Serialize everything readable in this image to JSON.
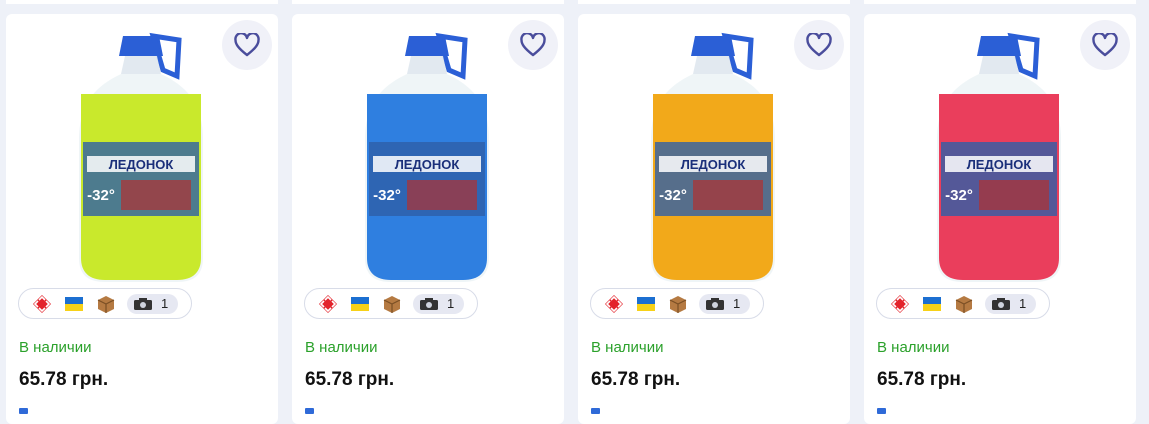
{
  "products": [
    {
      "liquid_color": "#c9e92c",
      "availability": "В наличии",
      "price": "65.78 грн.",
      "photo_count": "1",
      "label_text": "ЛЕДОНОК",
      "label_temp": "-32°"
    },
    {
      "liquid_color": "#2f7fe0",
      "availability": "В наличии",
      "price": "65.78 грн.",
      "photo_count": "1",
      "label_text": "ЛЕДОНОК",
      "label_temp": "-32°"
    },
    {
      "liquid_color": "#f2a91a",
      "availability": "В наличии",
      "price": "65.78 грн.",
      "photo_count": "1",
      "label_text": "ЛЕДОНОК",
      "label_temp": "-32°"
    },
    {
      "liquid_color": "#ea3e5c",
      "availability": "В наличии",
      "price": "65.78 грн.",
      "photo_count": "1",
      "label_text": "ЛЕДОНОК",
      "label_temp": "-32°"
    }
  ],
  "icons": {
    "favorite": "heart-icon",
    "delivery": "nova-poshta-icon",
    "origin": "ukraine-flag-icon",
    "package": "package-icon",
    "photos": "camera-icon"
  },
  "colors": {
    "background": "#eef1f8",
    "availability": "#2ba12b",
    "heart": "#4a4d9c",
    "delivery_red": "#e3232b"
  }
}
